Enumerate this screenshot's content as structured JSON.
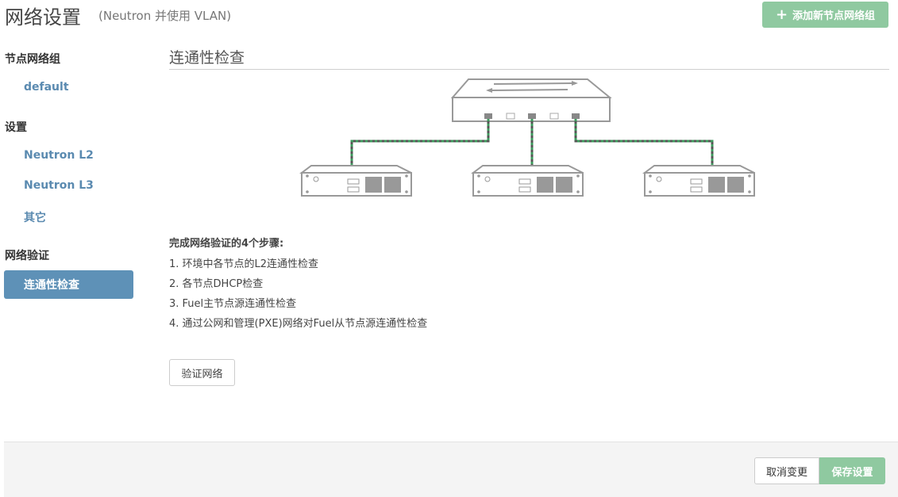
{
  "header": {
    "title": "网络设置",
    "subtitle": "(Neutron 并使用 VLAN)",
    "add_button_label": "添加新节点网络组"
  },
  "sidebar": {
    "groups": [
      {
        "label": "节点网络组",
        "items": [
          {
            "label": "default"
          }
        ]
      },
      {
        "label": "设置",
        "items": [
          {
            "label": "Neutron L2"
          },
          {
            "label": "Neutron L3"
          },
          {
            "label": "其它"
          }
        ]
      },
      {
        "label": "网络验证",
        "items": [
          {
            "label": "连通性检查",
            "active": true
          }
        ]
      }
    ]
  },
  "main": {
    "section_title": "连通性检查",
    "steps_title": "完成网络验证的4个步骤:",
    "steps": [
      "1. 环境中各节点的L2连通性检查",
      "2. 各节点DHCP检查",
      "3. Fuel主节点源连通性检查",
      "4. 通过公网和管理(PXE)网络对Fuel从节点源连通性检查"
    ],
    "verify_button_label": "验证网络"
  },
  "footer": {
    "cancel_label": "取消变更",
    "save_label": "保存设置"
  },
  "colors": {
    "accent_green": "#8fc9a0",
    "active_blue": "#5e91b7",
    "link_blue": "#5a8ab0"
  }
}
